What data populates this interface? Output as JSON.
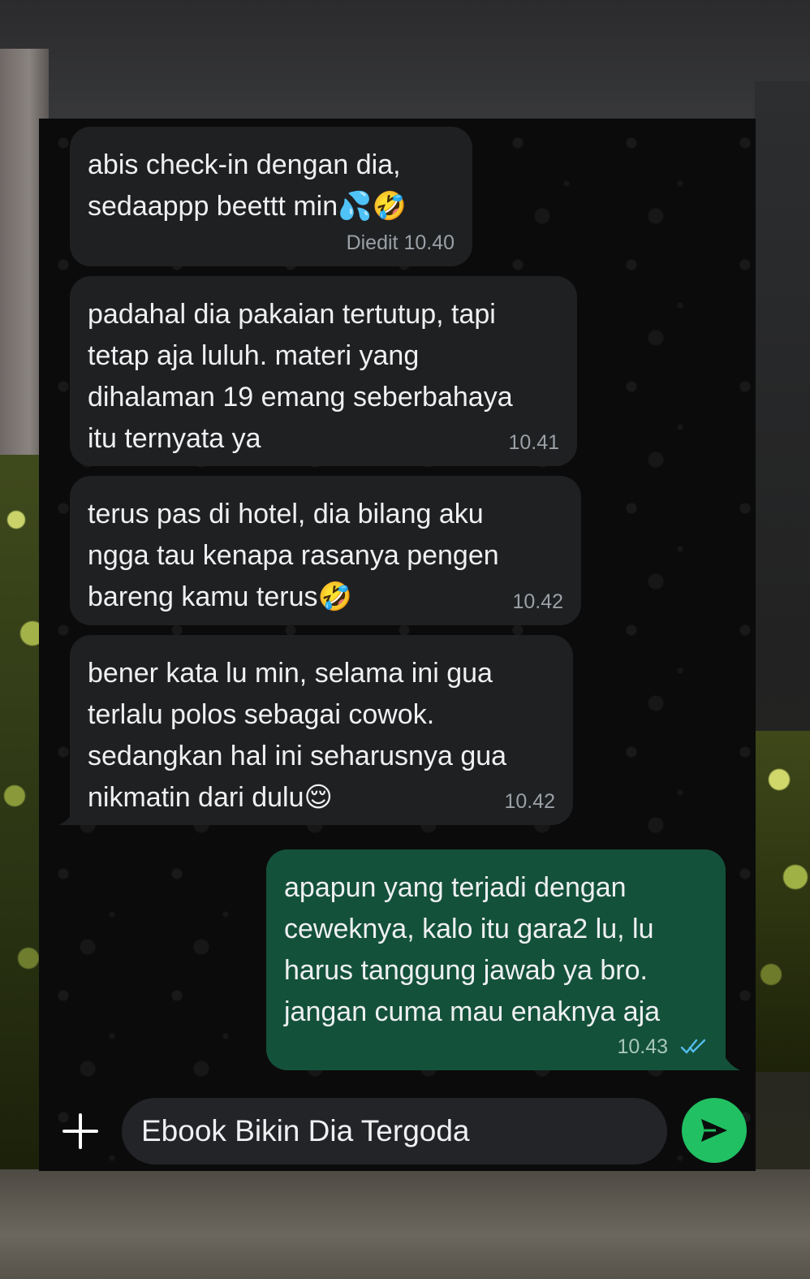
{
  "messages": [
    {
      "direction": "incoming",
      "text": "abis check-in dengan dia,\nsedaappp beettt min💦🤣",
      "time": "10.40",
      "edited_label": "Diedit"
    },
    {
      "direction": "incoming",
      "text": "padahal dia pakaian tertutup, tapi\ntetap aja luluh. materi yang\ndihalaman 19 emang seberbahaya\nitu ternyata ya",
      "time": "10.41"
    },
    {
      "direction": "incoming",
      "text": "terus pas di hotel, dia bilang aku\nngga tau kenapa rasanya pengen\nbareng kamu terus🤣",
      "time": "10.42"
    },
    {
      "direction": "incoming",
      "text": "bener kata lu min, selama ini gua\nterlalu polos sebagai cowok.\nsedangkan hal ini seharusnya gua\nnikmatin dari dulu😌",
      "time": "10.42"
    },
    {
      "direction": "outgoing",
      "text": "apapun yang terjadi dengan\nceweknya, kalo itu gara2 lu, lu\nharus tanggung jawab ya bro.\njangan cuma mau enaknya aja",
      "time": "10.43",
      "status": "read"
    }
  ],
  "composer": {
    "text": "Ebook Bikin Dia Tergoda",
    "icons": {
      "attach": "plus-icon",
      "sticker": "sticker-icon",
      "send": "send-icon"
    }
  },
  "colors": {
    "incoming_bubble": "#1f2022",
    "outgoing_bubble": "#14513b",
    "send_button": "#21c063",
    "read_ticks": "#53bdeb"
  }
}
